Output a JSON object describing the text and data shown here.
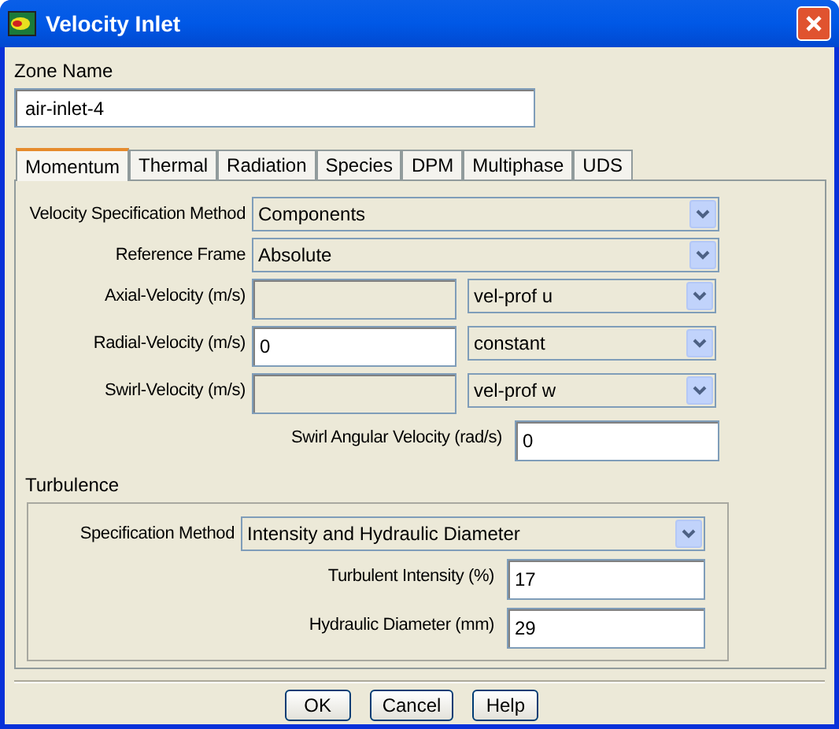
{
  "window": {
    "title": "Velocity Inlet"
  },
  "zone_name": {
    "label": "Zone Name",
    "value": "air-inlet-4"
  },
  "tabs": [
    {
      "label": "Momentum",
      "selected": true
    },
    {
      "label": "Thermal",
      "selected": false
    },
    {
      "label": "Radiation",
      "selected": false
    },
    {
      "label": "Species",
      "selected": false
    },
    {
      "label": "DPM",
      "selected": false
    },
    {
      "label": "Multiphase",
      "selected": false
    },
    {
      "label": "UDS",
      "selected": false
    }
  ],
  "momentum": {
    "rows": [
      {
        "kind": "select",
        "label": "Velocity Specification Method",
        "value": "Components"
      },
      {
        "kind": "select",
        "label": "Reference Frame",
        "value": "Absolute"
      },
      {
        "kind": "input_select",
        "label": "Axial-Velocity (m/s)",
        "input": {
          "disabled": true
        },
        "select": "vel-prof u"
      },
      {
        "kind": "input_select",
        "label": "Radial-Velocity (m/s)",
        "input": {
          "value": "0",
          "disabled": false
        },
        "select": "constant"
      },
      {
        "kind": "input_select",
        "label": "Swirl-Velocity (m/s)",
        "input": {
          "disabled": true
        },
        "select": "vel-prof w"
      },
      {
        "kind": "input",
        "label": "Swirl Angular Velocity (rad/s)",
        "value": "0"
      }
    ],
    "turbulence": {
      "title": "Turbulence",
      "rows": [
        {
          "kind": "select",
          "label": "Specification Method",
          "value": "Intensity and Hydraulic Diameter"
        },
        {
          "kind": "input",
          "label": "Turbulent Intensity (%)",
          "value": "17"
        },
        {
          "kind": "input",
          "label": "Hydraulic Diameter (mm)",
          "value": "29"
        }
      ]
    }
  },
  "buttons": [
    "OK",
    "Cancel",
    "Help"
  ]
}
